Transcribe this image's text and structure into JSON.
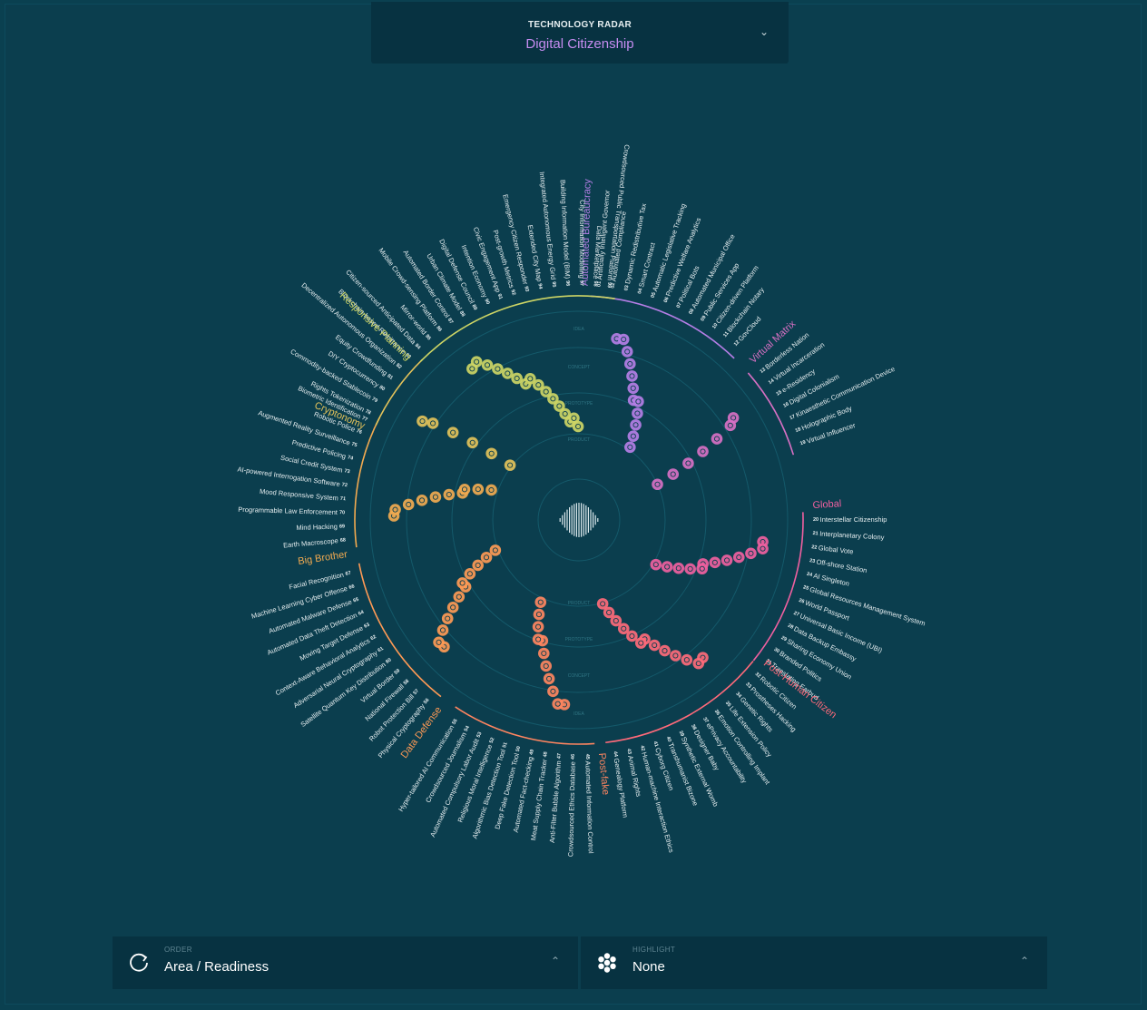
{
  "header": {
    "subtitle": "TECHNOLOGY RADAR",
    "title": "Digital Citizenship"
  },
  "rings": [
    "PRODUCT",
    "PROTOTYPE",
    "CONCEPT",
    "IDEA"
  ],
  "inner_rings": [
    "PRODUCT",
    "PROTOTYPE",
    "CONCEPT",
    "IDEA"
  ],
  "sectors": [
    {
      "name": "Automated Bureaucracy",
      "color": "#b57ee6",
      "items": [
        {
          "n": "01",
          "label": "Artificially Intelligent Governor"
        },
        {
          "n": "02",
          "label": "Automated Compliance"
        },
        {
          "n": "03",
          "label": "Dynamic Redistributive Tax"
        },
        {
          "n": "04",
          "label": "Smart Contract"
        },
        {
          "n": "05",
          "label": "Automatic Legislative Tracking"
        },
        {
          "n": "06",
          "label": "Predictive Welfare Analytics"
        },
        {
          "n": "07",
          "label": "Political Bots"
        },
        {
          "n": "08",
          "label": "Automated Municipal Office"
        },
        {
          "n": "09",
          "label": "Public Services App"
        },
        {
          "n": "10",
          "label": "Citizen-driven Platform"
        },
        {
          "n": "11",
          "label": "Blockchain Notary"
        },
        {
          "n": "12",
          "label": "GovCloud"
        }
      ]
    },
    {
      "name": "Virtual Matrix",
      "color": "#d870c4",
      "items": [
        {
          "n": "13",
          "label": "Borderless Nation"
        },
        {
          "n": "14",
          "label": "Virtual Incarceration"
        },
        {
          "n": "15",
          "label": "e-Residency"
        },
        {
          "n": "16",
          "label": "Digital Colonialism"
        },
        {
          "n": "17",
          "label": "Kinaesthetic Communication Device"
        },
        {
          "n": "18",
          "label": "Holographic Body"
        },
        {
          "n": "19",
          "label": "Virtual Influencer"
        }
      ]
    },
    {
      "name": "Global",
      "color": "#f060a0",
      "items": [
        {
          "n": "20",
          "label": "Interstellar Citizenship"
        },
        {
          "n": "21",
          "label": "Interplanetary Colony"
        },
        {
          "n": "22",
          "label": "Global Vote"
        },
        {
          "n": "23",
          "label": "Off-shore Station"
        },
        {
          "n": "24",
          "label": "AI Singleton"
        },
        {
          "n": "25",
          "label": "Global Resources Management System"
        },
        {
          "n": "26",
          "label": "World Passport"
        },
        {
          "n": "27",
          "label": "Universal Basic Income (UBI)"
        },
        {
          "n": "28",
          "label": "Data Backup Embassy"
        },
        {
          "n": "29",
          "label": "Sharing Economy Union"
        },
        {
          "n": "30",
          "label": "Branded Politics"
        },
        {
          "n": "31",
          "label": "Translating Earbud"
        }
      ]
    },
    {
      "name": "Post-Human Citizen",
      "color": "#ff6a7a",
      "items": [
        {
          "n": "32",
          "label": "Robotic Citizen"
        },
        {
          "n": "33",
          "label": "Prostheses Hacking"
        },
        {
          "n": "34",
          "label": "Genetic Rights"
        },
        {
          "n": "35",
          "label": "Life Extension Policy"
        },
        {
          "n": "36",
          "label": "Emotion Controlling Implant"
        },
        {
          "n": "37",
          "label": "ePrivacy Accountability"
        },
        {
          "n": "38",
          "label": "Designer Baby"
        },
        {
          "n": "39",
          "label": "Synthetic External Womb"
        },
        {
          "n": "40",
          "label": "Transhumanist Bizone"
        },
        {
          "n": "41",
          "label": "Cyborg Citizen"
        },
        {
          "n": "42",
          "label": "Human-machine Interaction Ethics"
        },
        {
          "n": "43",
          "label": "Animal Rights"
        },
        {
          "n": "44",
          "label": "Genealogy Platform"
        }
      ]
    },
    {
      "name": "Post-fake",
      "color": "#ff8560",
      "items": [
        {
          "n": "45",
          "label": "Automated Information Control"
        },
        {
          "n": "46",
          "label": "Crowdsourced Ethics Database"
        },
        {
          "n": "47",
          "label": "Anti-Filter Bubble Algorithm"
        },
        {
          "n": "48",
          "label": "Meat Supply Chain Tracker"
        },
        {
          "n": "49",
          "label": "Automated Fact-checking"
        },
        {
          "n": "50",
          "label": "Deep Fake Detection Tool"
        },
        {
          "n": "51",
          "label": "Algorithmic Bias Detection Tool"
        },
        {
          "n": "52",
          "label": "Religious Moral Intelligence"
        },
        {
          "n": "53",
          "label": "Automated Compulsory Labor Audit"
        },
        {
          "n": "54",
          "label": "Crowdsourced Journalism"
        },
        {
          "n": "55",
          "label": "Hyper-tailored AI Communication"
        }
      ]
    },
    {
      "name": "Data Defense",
      "color": "#ff9a55",
      "items": [
        {
          "n": "56",
          "label": "Physical Cryptography"
        },
        {
          "n": "57",
          "label": "Robot Protection Bill"
        },
        {
          "n": "58",
          "label": "National Firewall"
        },
        {
          "n": "59",
          "label": "Virtual Border"
        },
        {
          "n": "60",
          "label": "Satellite Quantum Key Distribution"
        },
        {
          "n": "61",
          "label": "Adversarial Neural Cryptography"
        },
        {
          "n": "62",
          "label": "Context-Aware Behavioral Analytics"
        },
        {
          "n": "63",
          "label": "Moving Target Defense"
        },
        {
          "n": "64",
          "label": "Automated Data Theft Detection"
        },
        {
          "n": "65",
          "label": "Automated Malware Defense"
        },
        {
          "n": "66",
          "label": "Machine Learning Cyber Offense"
        },
        {
          "n": "67",
          "label": "Facial Recognition"
        }
      ]
    },
    {
      "name": "Big Brother",
      "color": "#f2aa50",
      "items": [
        {
          "n": "68",
          "label": "Earth Macroscope"
        },
        {
          "n": "69",
          "label": "Mind Hacking"
        },
        {
          "n": "70",
          "label": "Programmable Law Enforcement"
        },
        {
          "n": "71",
          "label": "Mood Responsive System"
        },
        {
          "n": "72",
          "label": "AI-powered Interrogation Software"
        },
        {
          "n": "73",
          "label": "Social Credit System"
        },
        {
          "n": "74",
          "label": "Predictive Policing"
        },
        {
          "n": "75",
          "label": "Augmented Reality Surveillance"
        },
        {
          "n": "76",
          "label": "Robotic Police"
        },
        {
          "n": "77",
          "label": "Biometric Identification"
        }
      ]
    },
    {
      "name": "Cryptonomy",
      "color": "#e3c25a",
      "items": [
        {
          "n": "78",
          "label": "Rights Tokenization"
        },
        {
          "n": "79",
          "label": "Commodity-backed Stablecoin"
        },
        {
          "n": "80",
          "label": "DIY Cryptocurrency"
        },
        {
          "n": "81",
          "label": "Equity Crowdfunding"
        },
        {
          "n": "82",
          "label": "Decentralized Autonomous Organization"
        },
        {
          "n": "83",
          "label": "Blockchain-based Remittance"
        }
      ]
    },
    {
      "name": "Responsive Planning",
      "color": "#cdd565",
      "items": [
        {
          "n": "84",
          "label": "Citizen-sourced Anticipated Data"
        },
        {
          "n": "85",
          "label": "Mirror-world"
        },
        {
          "n": "86",
          "label": "Mobile Crowd-sensing Platform"
        },
        {
          "n": "87",
          "label": "Automated Border Control"
        },
        {
          "n": "88",
          "label": "Urban Climate Model"
        },
        {
          "n": "89",
          "label": "Digital Defense Council"
        },
        {
          "n": "90",
          "label": "Intention Economy"
        },
        {
          "n": "91",
          "label": "Civic Engagement App"
        },
        {
          "n": "92",
          "label": "Post-growth Metrics"
        },
        {
          "n": "93",
          "label": "Emergency Citizen Responder"
        },
        {
          "n": "94",
          "label": "Extended City Map"
        },
        {
          "n": "95",
          "label": "Integrated Autonomous Energy Grid"
        },
        {
          "n": "96",
          "label": "Building Information Model (BIM)"
        },
        {
          "n": "97",
          "label": "City Information Modelling"
        },
        {
          "n": "98",
          "label": "Data Marketplace"
        },
        {
          "n": "99",
          "label": "Crowdsourced Public Transportation Platform"
        }
      ]
    }
  ],
  "controls": {
    "order_label": "ORDER",
    "order_value": "Area / Readiness",
    "highlight_label": "HIGHLIGHT",
    "highlight_value": "None"
  },
  "icons": {
    "order": "refresh-icon",
    "highlight": "flower-dots-icon",
    "selector": "chevron-down-icon",
    "center": "radar-logo-icon"
  }
}
